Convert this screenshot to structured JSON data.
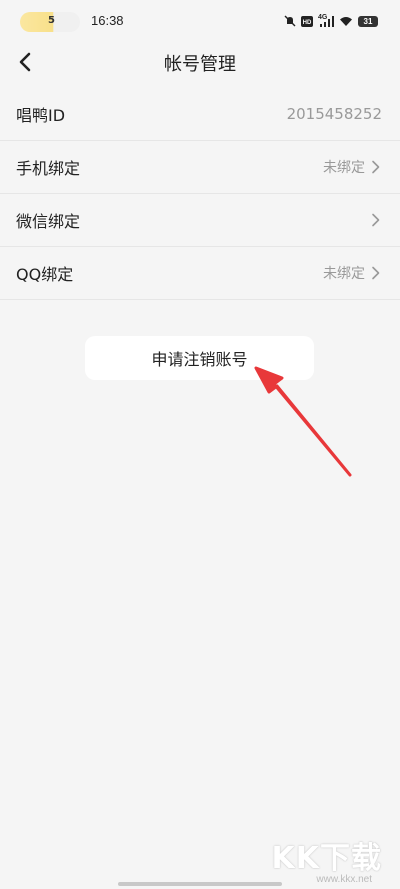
{
  "status_bar": {
    "pill_number": "5",
    "time": "16:38",
    "network": "4G",
    "battery": "31"
  },
  "nav": {
    "title": "帐号管理"
  },
  "rows": [
    {
      "label": "唱鸭ID",
      "value": "2015458252"
    },
    {
      "label": "手机绑定",
      "value": "未绑定"
    },
    {
      "label": "微信绑定",
      "value": ""
    },
    {
      "label": "QQ绑定",
      "value": "未绑定"
    }
  ],
  "button": {
    "label": "申请注销账号"
  },
  "annotation": {
    "arrow_color": "#e8383a"
  },
  "watermark": {
    "text": "KK下载",
    "url": "www.kkx.net"
  }
}
